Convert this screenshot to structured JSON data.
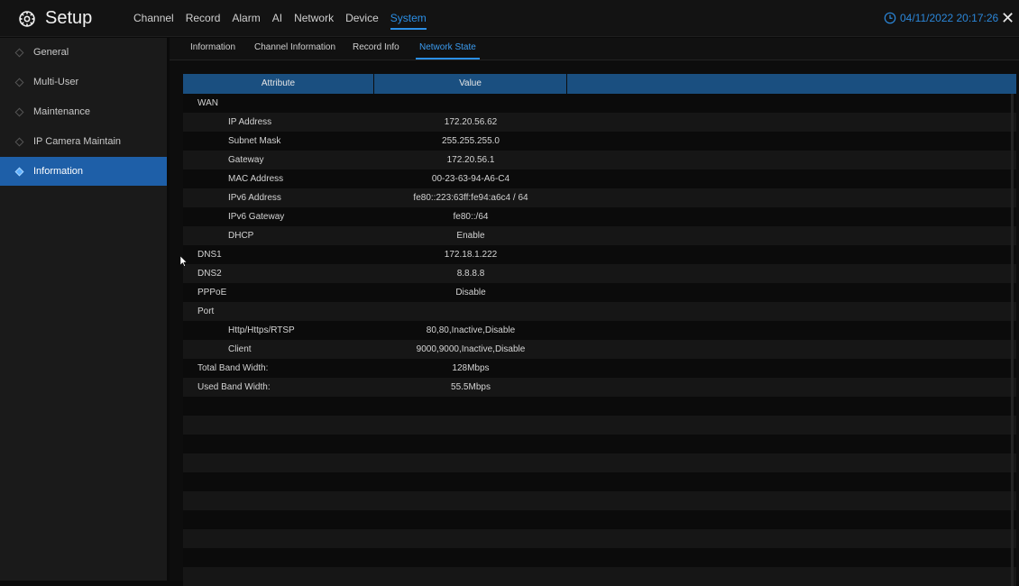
{
  "app": {
    "title": "Setup"
  },
  "menu": [
    "Channel",
    "Record",
    "Alarm",
    "AI",
    "Network",
    "Device",
    "System"
  ],
  "datetime": "04/11/2022 20:17:26",
  "close_label": "✕",
  "sidebar": {
    "items": [
      {
        "label": "General"
      },
      {
        "label": "Multi-User"
      },
      {
        "label": "Maintenance"
      },
      {
        "label": "IP Camera Maintain"
      },
      {
        "label": "Information"
      }
    ]
  },
  "subtabs": [
    "Information",
    "Channel Information",
    "Record Info",
    "Network State"
  ],
  "table": {
    "headers": [
      "Attribute",
      "Value"
    ],
    "rows": [
      {
        "attr": "WAN",
        "value": "",
        "level": 0
      },
      {
        "attr": "IP Address",
        "value": "172.20.56.62",
        "level": 1
      },
      {
        "attr": "Subnet Mask",
        "value": "255.255.255.0",
        "level": 1
      },
      {
        "attr": "Gateway",
        "value": "172.20.56.1",
        "level": 1
      },
      {
        "attr": "MAC Address",
        "value": "00-23-63-94-A6-C4",
        "level": 1
      },
      {
        "attr": "IPv6 Address",
        "value": "fe80::223:63ff:fe94:a6c4 / 64",
        "level": 1
      },
      {
        "attr": "IPv6 Gateway",
        "value": "fe80::/64",
        "level": 1
      },
      {
        "attr": "DHCP",
        "value": "Enable",
        "level": 1
      },
      {
        "attr": "DNS1",
        "value": "172.18.1.222",
        "level": 0
      },
      {
        "attr": "DNS2",
        "value": "8.8.8.8",
        "level": 0
      },
      {
        "attr": "PPPoE",
        "value": "Disable",
        "level": 0
      },
      {
        "attr": "Port",
        "value": "",
        "level": 0
      },
      {
        "attr": "Http/Https/RTSP",
        "value": "80,80,Inactive,Disable",
        "level": 1
      },
      {
        "attr": "Client",
        "value": "9000,9000,Inactive,Disable",
        "level": 1
      },
      {
        "attr": "Total Band Width:",
        "value": "128Mbps",
        "level": 0
      },
      {
        "attr": "Used Band Width:",
        "value": "55.5Mbps",
        "level": 0
      },
      {
        "attr": "",
        "value": "",
        "level": 0
      },
      {
        "attr": "",
        "value": "",
        "level": 0
      },
      {
        "attr": "",
        "value": "",
        "level": 0
      },
      {
        "attr": "",
        "value": "",
        "level": 0
      },
      {
        "attr": "",
        "value": "",
        "level": 0
      },
      {
        "attr": "",
        "value": "",
        "level": 0
      },
      {
        "attr": "",
        "value": "",
        "level": 0
      },
      {
        "attr": "",
        "value": "",
        "level": 0
      },
      {
        "attr": "",
        "value": "",
        "level": 0
      },
      {
        "attr": "",
        "value": "",
        "level": 0
      }
    ]
  },
  "colors": {
    "accent": "#2b8fe6",
    "header_bg": "#1a4f80",
    "active_sidebar": "#1e5fa8"
  }
}
